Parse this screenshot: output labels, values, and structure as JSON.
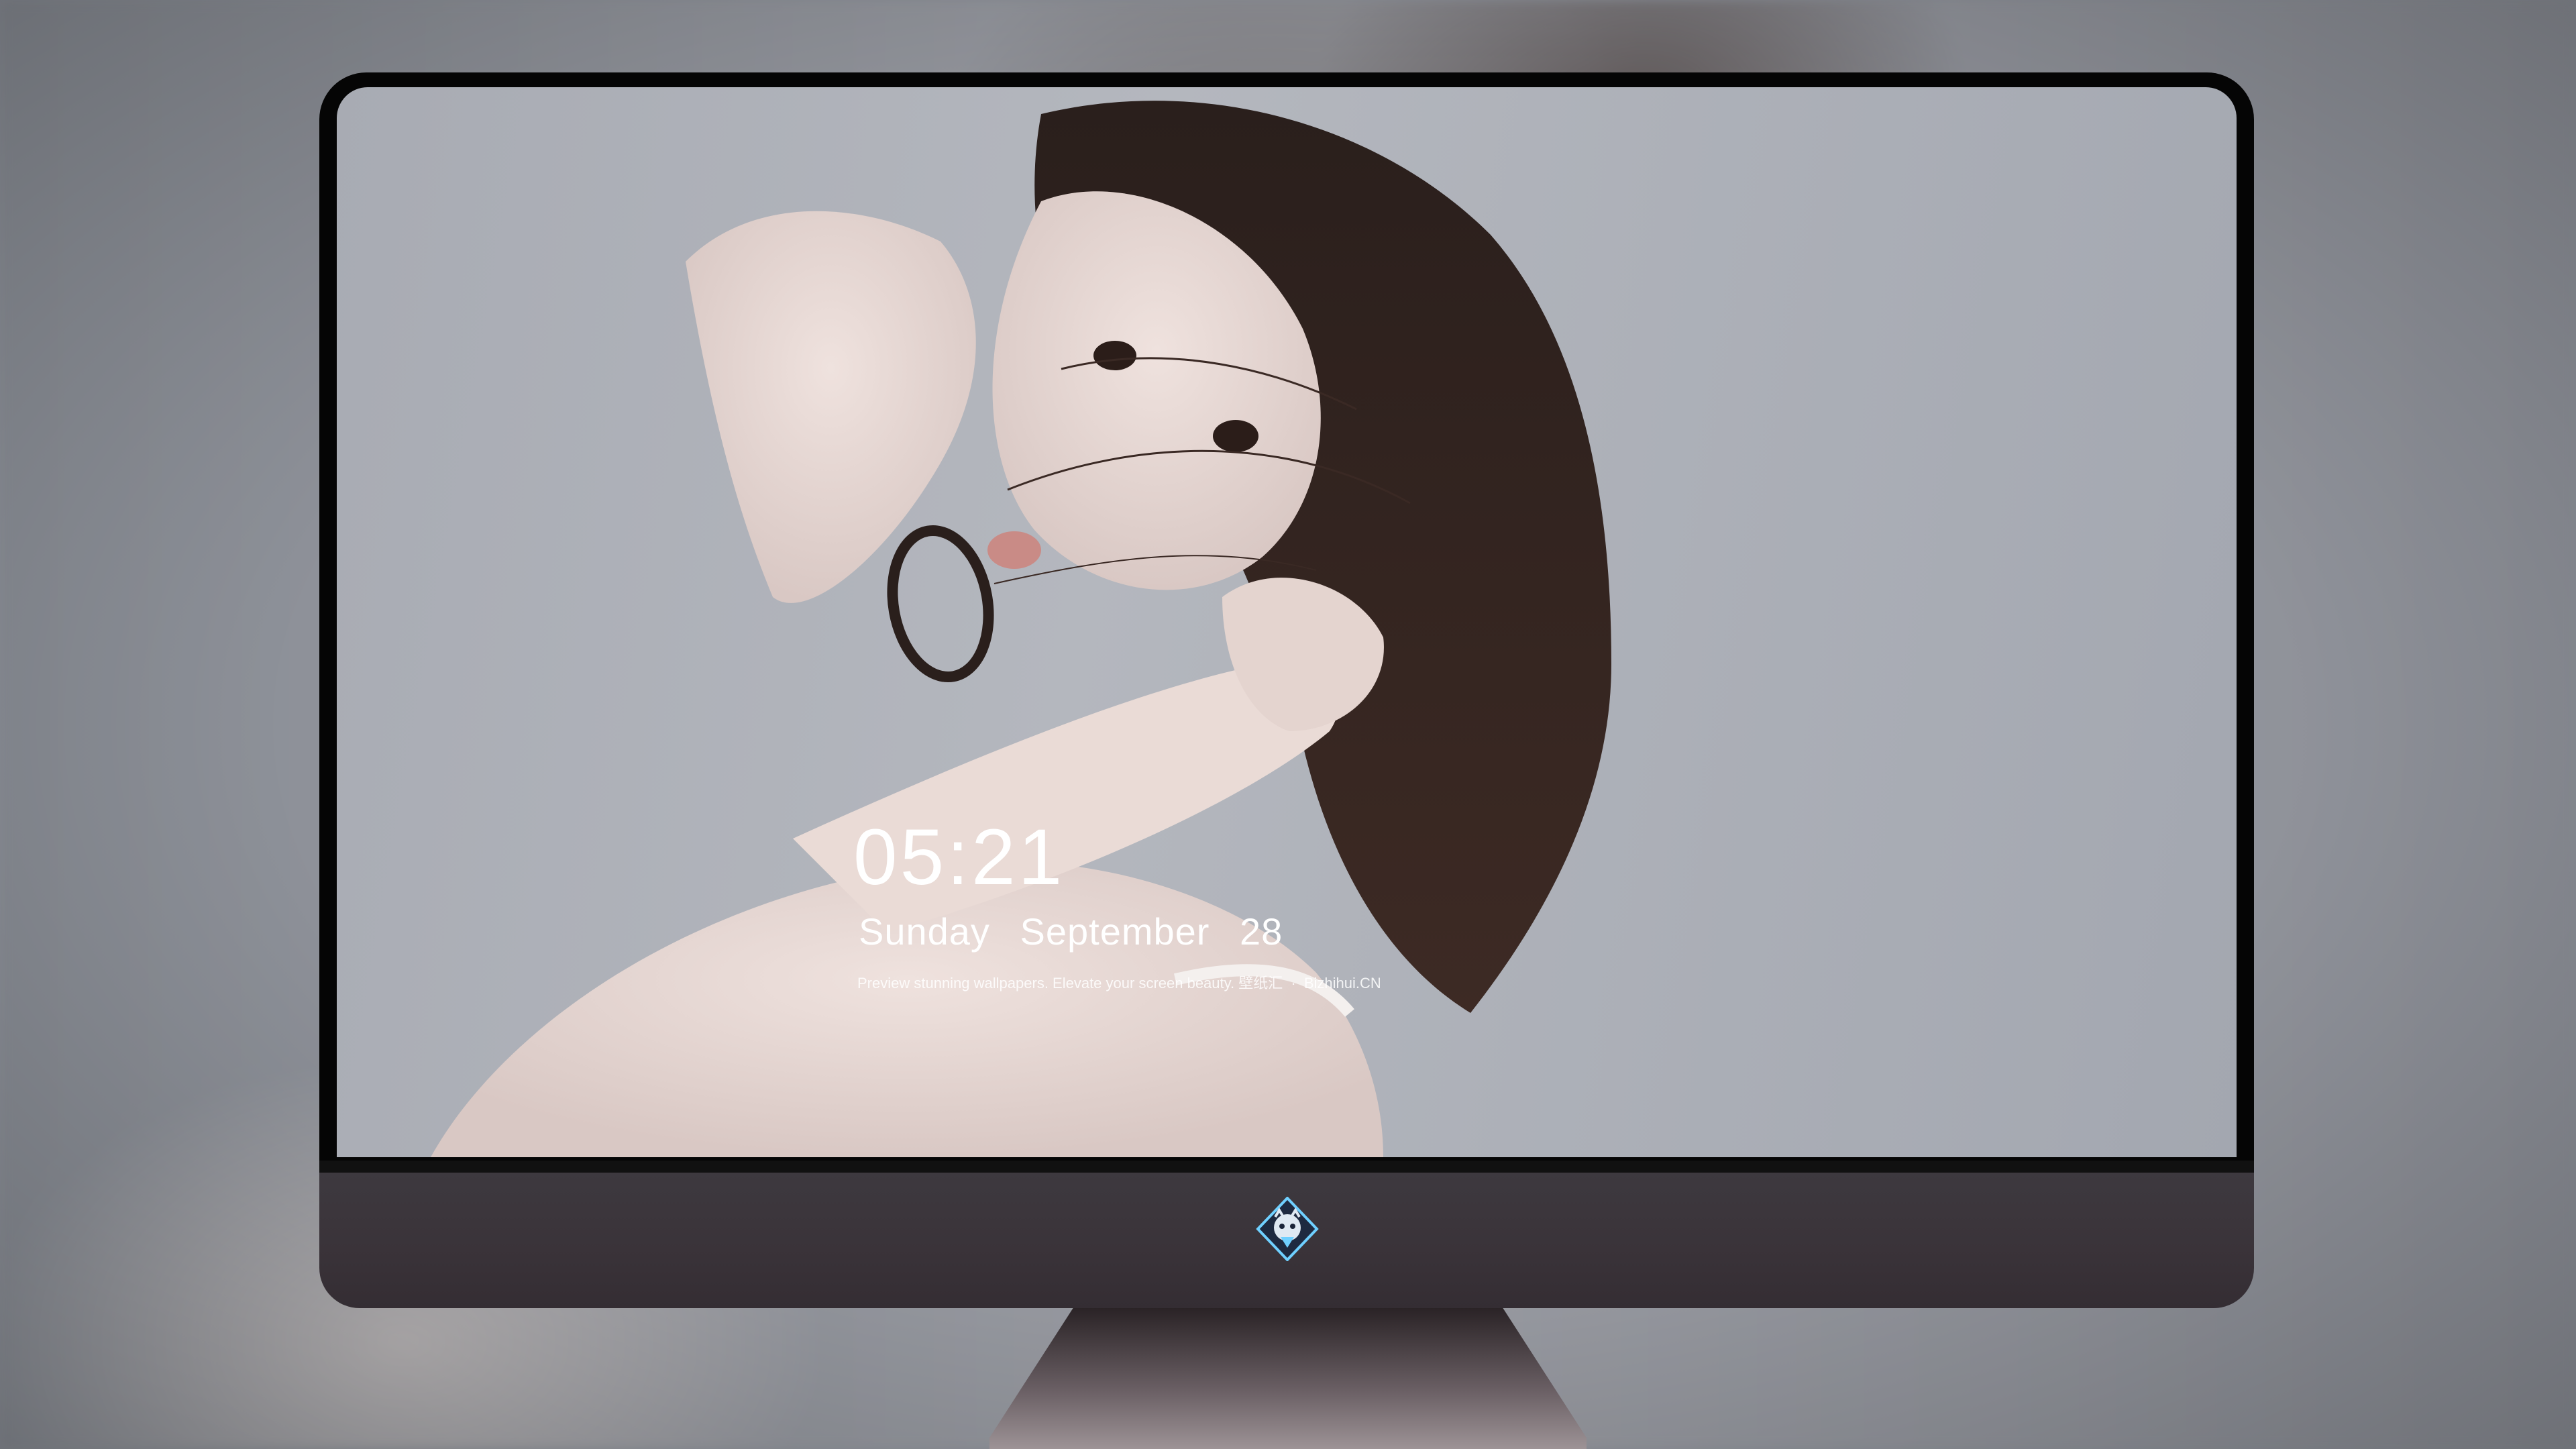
{
  "lock_screen": {
    "time": "05:21",
    "weekday": "Sunday",
    "month": "September",
    "day": "28",
    "tagline_main": "Preview stunning wallpapers. Elevate your screen beauty.",
    "tagline_cn": "壁纸汇",
    "tagline_site": "Bizhihui.CN"
  },
  "dock": {
    "apps": [
      {
        "name": "messages-icon",
        "color": "#34c759"
      },
      {
        "name": "weather-icon",
        "color": "#2f8ff0"
      },
      {
        "name": "clock-icon",
        "color": "#1c1c1e"
      },
      {
        "name": "preview-icon",
        "color": "#f2c94c"
      },
      {
        "name": "clips-icon",
        "color": "#5ac8fa"
      },
      {
        "name": "notes-icon",
        "color": "#fbd34d"
      },
      {
        "name": "photo-booth-icon",
        "color": "#e74c3c"
      },
      {
        "name": "music-icon",
        "color": "#d63af9"
      },
      {
        "name": "app-store-icon",
        "color": "#1b8cf2"
      },
      {
        "name": "camera-icon",
        "color": "#8e8e93"
      }
    ]
  }
}
